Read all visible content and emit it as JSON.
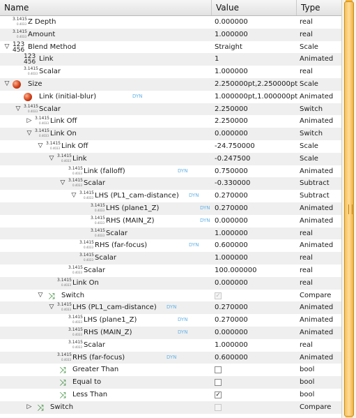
{
  "header": {
    "name": "Name",
    "value": "Value",
    "type": "Type"
  },
  "rows": [
    {
      "level": 0,
      "exp": "",
      "icon": "num",
      "name": "Z Depth",
      "value": "0.000000",
      "type": "real"
    },
    {
      "level": 0,
      "exp": "",
      "icon": "num",
      "name": "Amount",
      "value": "1.000000",
      "type": "real"
    },
    {
      "level": 0,
      "exp": "down",
      "icon": "bignum",
      "name": "Blend Method",
      "value": "Straight",
      "type": "Scale"
    },
    {
      "level": 1,
      "exp": "",
      "icon": "bignum",
      "name": "Link",
      "value": "1",
      "type": "Animated"
    },
    {
      "level": 1,
      "exp": "",
      "icon": "num",
      "name": "Scalar",
      "value": "1.000000",
      "type": "real"
    },
    {
      "level": 0,
      "exp": "down",
      "icon": "ball",
      "name": "Size",
      "value": "2.250000pt,2.250000pt",
      "type": "Scale"
    },
    {
      "level": 1,
      "exp": "",
      "icon": "ball",
      "name": "Link (initial-blur)",
      "dyn": true,
      "dynX": 190,
      "value": "1.000000pt,1.000000pt",
      "type": "Animated"
    },
    {
      "level": 1,
      "exp": "down",
      "icon": "num",
      "name": "Scalar",
      "value": "2.250000",
      "type": "Switch"
    },
    {
      "level": 2,
      "exp": "right",
      "icon": "num",
      "name": "Link Off",
      "value": "2.250000",
      "type": "Animated"
    },
    {
      "level": 2,
      "exp": "down",
      "icon": "num",
      "name": "Link On",
      "value": "0.000000",
      "type": "Switch"
    },
    {
      "level": 3,
      "exp": "down",
      "icon": "num",
      "name": "Link Off",
      "value": "-24.750000",
      "type": "Scale"
    },
    {
      "level": 4,
      "exp": "down",
      "icon": "num",
      "name": "Link",
      "value": "-0.247500",
      "type": "Scale"
    },
    {
      "level": 5,
      "exp": "",
      "icon": "num",
      "name": "Link (falloff)",
      "dyn": true,
      "dynX": 255,
      "value": "0.750000",
      "type": "Animated"
    },
    {
      "level": 5,
      "exp": "down",
      "icon": "num",
      "name": "Scalar",
      "value": "-0.330000",
      "type": "Subtract"
    },
    {
      "level": 6,
      "exp": "down",
      "icon": "num",
      "name": "LHS (PL1_cam-distance)",
      "dyn": true,
      "dynX": 271,
      "value": "0.270000",
      "type": "Subtract"
    },
    {
      "level": 7,
      "exp": "",
      "icon": "num",
      "name": "LHS (plane1_Z)",
      "dyn": true,
      "dynX": 287,
      "value": "0.270000",
      "type": "Animated"
    },
    {
      "level": 7,
      "exp": "",
      "icon": "num",
      "name": "RHS (MAIN_Z)",
      "dyn": true,
      "dynX": 287,
      "value": "0.000000",
      "type": "Animated"
    },
    {
      "level": 7,
      "exp": "",
      "icon": "num",
      "name": "Scalar",
      "value": "1.000000",
      "type": "real"
    },
    {
      "level": 6,
      "exp": "",
      "icon": "num",
      "name": "RHS (far-focus)",
      "dyn": true,
      "dynX": 271,
      "value": "0.600000",
      "type": "Animated"
    },
    {
      "level": 6,
      "exp": "",
      "icon": "num",
      "name": "Scalar",
      "value": "1.000000",
      "type": "real"
    },
    {
      "level": 5,
      "exp": "",
      "icon": "num",
      "name": "Scalar",
      "value": "100.000000",
      "type": "real"
    },
    {
      "level": 4,
      "exp": "",
      "icon": "num",
      "name": "Link On",
      "value": "0.000000",
      "type": "real"
    },
    {
      "level": 3,
      "exp": "down",
      "icon": "switch",
      "name": "Switch",
      "check": "disabled-checked",
      "type": "Compare"
    },
    {
      "level": 4,
      "exp": "down",
      "icon": "num",
      "name": "LHS (PL1_cam-distance)",
      "dyn": true,
      "dynX": 239,
      "value": "0.270000",
      "type": "Animated"
    },
    {
      "level": 5,
      "exp": "",
      "icon": "num",
      "name": "LHS (plane1_Z)",
      "dyn": true,
      "dynX": 255,
      "value": "0.270000",
      "type": "Animated"
    },
    {
      "level": 5,
      "exp": "",
      "icon": "num",
      "name": "RHS (MAIN_Z)",
      "dyn": true,
      "dynX": 255,
      "value": "0.000000",
      "type": "Animated"
    },
    {
      "level": 5,
      "exp": "",
      "icon": "num",
      "name": "Scalar",
      "value": "1.000000",
      "type": "real"
    },
    {
      "level": 4,
      "exp": "",
      "icon": "num",
      "name": "RHS (far-focus)",
      "dyn": true,
      "dynX": 239,
      "value": "0.600000",
      "type": "Animated"
    },
    {
      "level": 4,
      "exp": "",
      "icon": "switch",
      "name": "Greater Than",
      "check": "unchecked",
      "type": "bool"
    },
    {
      "level": 4,
      "exp": "",
      "icon": "switch",
      "name": "Equal to",
      "check": "unchecked",
      "type": "bool"
    },
    {
      "level": 4,
      "exp": "",
      "icon": "switch",
      "name": "Less Than",
      "check": "checked",
      "type": "bool"
    },
    {
      "level": 2,
      "exp": "right",
      "icon": "switch",
      "name": "Switch",
      "check": "disabled",
      "type": "Compare"
    }
  ],
  "glyphs": {
    "num_a": "3.1415",
    "num_b": "0.4033",
    "big": "123 456",
    "dyn": "DYN",
    "down": "▽",
    "right": "▷",
    "switch": "⤨",
    "tick": "✓"
  }
}
